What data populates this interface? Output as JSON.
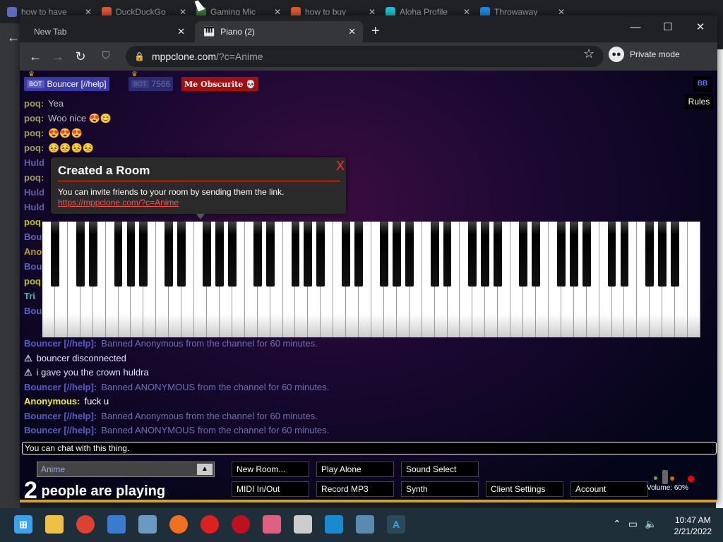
{
  "bg_tabs": [
    {
      "title": "how to have",
      "color": "#5c6bc0"
    },
    {
      "title": "DuckDuckGo",
      "color": "#de5833"
    },
    {
      "title": "Gaming Mic",
      "color": "#2e7d32"
    },
    {
      "title": "how to buy",
      "color": "#de5833"
    },
    {
      "title": "Aloha Profile",
      "color": "#20c0d0"
    },
    {
      "title": "Throwaway",
      "color": "#1e88e5"
    }
  ],
  "browser": {
    "tabs": [
      {
        "title": "New Tab"
      },
      {
        "title": "Piano (2)"
      }
    ],
    "url_host": "mppclone.com",
    "url_path": "/?c=Anime",
    "private_label": "Private mode"
  },
  "top_players": [
    {
      "tag": "BOT",
      "name": "Bouncer [//help]",
      "color": "#5a5ac8"
    },
    {
      "tag": "BOT",
      "name": "7566",
      "color": "#3a3a80"
    },
    {
      "name": "Me Obscurite",
      "color": "#a01010"
    }
  ],
  "rules_label": "Rules",
  "chat_top": [
    {
      "name": "poq:",
      "text": "Yea",
      "color": "#a0a060"
    },
    {
      "name": "poq:",
      "text": "Woo nice 😍😊",
      "color": "#a0a060"
    },
    {
      "name": "poq:",
      "text": "😍😍😍",
      "color": "#a0a060"
    },
    {
      "name": "poq:",
      "text": "😣😣😣😣",
      "color": "#a0a060"
    },
    {
      "name": "Huld",
      "text": "",
      "color": "#6060a0"
    },
    {
      "name": "poq:",
      "text": "",
      "color": "#a0a060"
    },
    {
      "name": "Huld",
      "text": "",
      "color": "#6060a0"
    },
    {
      "name": "Huld",
      "text": "",
      "color": "#6060a0"
    },
    {
      "name": "poq",
      "text": "",
      "color": "#c0c020"
    },
    {
      "name": "Bou",
      "text": "",
      "color": "#6060c0"
    },
    {
      "name": "Ano",
      "text": "",
      "color": "#c0a020"
    },
    {
      "name": "Bou",
      "text": "",
      "color": "#6060c0"
    },
    {
      "name": "poq",
      "text": "",
      "color": "#c0c020"
    },
    {
      "name": "Tri",
      "text": "",
      "color": "#20c0a0"
    },
    {
      "name": "Bou",
      "text": "",
      "color": "#6060c0"
    }
  ],
  "chat_bottom": [
    {
      "name": "Bouncer [//help]:",
      "text": "Banned Anonymous from the channel for 60 minutes.",
      "color": "#5a5ac8",
      "textcolor": "#7070b0"
    },
    {
      "name": "⚠",
      "text": "bouncer disconnected",
      "color": "#c0c0e0",
      "textcolor": "#e0e0ff"
    },
    {
      "name": "⚠",
      "text": "i gave you the crown huldra",
      "color": "#c0c0e0",
      "textcolor": "#e0e0ff"
    },
    {
      "name": "Bouncer [//help]:",
      "text": "Banned ANONYMOUS from the channel for 60 minutes.",
      "color": "#5a5ac8",
      "textcolor": "#7070b0"
    },
    {
      "name": "Anonymous:",
      "text": "fuck u",
      "color": "#f0f020",
      "textcolor": "#ffffff"
    },
    {
      "name": "Bouncer [//help]:",
      "text": "Banned Anonymous from the channel for 60 minutes.",
      "color": "#5a5ac8",
      "textcolor": "#7070b0"
    },
    {
      "name": "Bouncer [//help]:",
      "text": "Banned ANONYMOUS from the channel for 60 minutes.",
      "color": "#5a5ac8",
      "textcolor": "#7070b0"
    }
  ],
  "chat_input_placeholder": "You can chat with this thing.",
  "popup": {
    "title": "Created a Room",
    "message": "You can invite friends to your room by sending them the link.",
    "link": "https://mppclone.com/?c=Anime",
    "close": "X"
  },
  "room_name": "Anime",
  "player_count": "2",
  "player_count_label": "people are playing",
  "buttons": {
    "new_room": "New Room...",
    "play_alone": "Play Alone",
    "sound_select": "Sound Select",
    "midi": "MIDI In/Out",
    "record": "Record MP3",
    "synth": "Synth",
    "client_settings": "Client Settings",
    "account": "Account"
  },
  "volume_label": "Volume: 60%",
  "clock": {
    "time": "10:47 AM",
    "date": "2/21/2022"
  }
}
